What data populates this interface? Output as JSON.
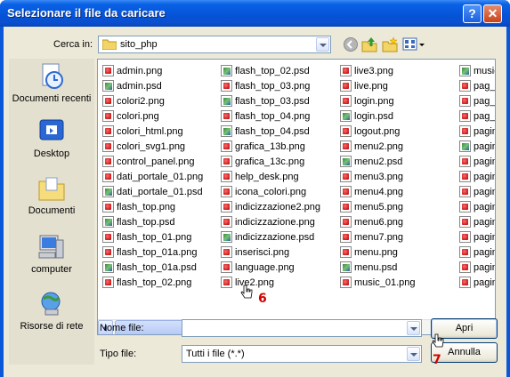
{
  "window": {
    "title": "Selezionare il file da caricare"
  },
  "lookin": {
    "label": "Cerca in:",
    "value": "sito_php"
  },
  "places": [
    {
      "label": "Documenti recenti"
    },
    {
      "label": "Desktop"
    },
    {
      "label": "Documenti"
    },
    {
      "label": "computer"
    },
    {
      "label": "Risorse di rete"
    }
  ],
  "files": {
    "col1": [
      {
        "name": "admin.png",
        "type": "png"
      },
      {
        "name": "admin.psd",
        "type": "psd"
      },
      {
        "name": "colori2.png",
        "type": "png"
      },
      {
        "name": "colori.png",
        "type": "png"
      },
      {
        "name": "colori_html.png",
        "type": "png"
      },
      {
        "name": "colori_svg1.png",
        "type": "png"
      },
      {
        "name": "control_panel.png",
        "type": "png"
      },
      {
        "name": "dati_portale_01.png",
        "type": "png"
      },
      {
        "name": "dati_portale_01.psd",
        "type": "psd"
      },
      {
        "name": "flash_top.png",
        "type": "png"
      },
      {
        "name": "flash_top.psd",
        "type": "psd"
      },
      {
        "name": "flash_top_01.png",
        "type": "png"
      },
      {
        "name": "flash_top_01a.png",
        "type": "png"
      },
      {
        "name": "flash_top_01a.psd",
        "type": "psd"
      },
      {
        "name": "flash_top_02.png",
        "type": "png"
      }
    ],
    "col2": [
      {
        "name": "flash_top_02.psd",
        "type": "psd"
      },
      {
        "name": "flash_top_03.png",
        "type": "png"
      },
      {
        "name": "flash_top_03.psd",
        "type": "psd"
      },
      {
        "name": "flash_top_04.png",
        "type": "png"
      },
      {
        "name": "flash_top_04.psd",
        "type": "psd"
      },
      {
        "name": "grafica_13b.png",
        "type": "png"
      },
      {
        "name": "grafica_13c.png",
        "type": "png"
      },
      {
        "name": "help_desk.png",
        "type": "png"
      },
      {
        "name": "icona_colori.png",
        "type": "png"
      },
      {
        "name": "indicizzazione2.png",
        "type": "png"
      },
      {
        "name": "indicizzazione.png",
        "type": "png"
      },
      {
        "name": "indicizzazione.psd",
        "type": "psd"
      },
      {
        "name": "inserisci.png",
        "type": "png"
      },
      {
        "name": "language.png",
        "type": "png"
      },
      {
        "name": "live2.png",
        "type": "png"
      }
    ],
    "col3": [
      {
        "name": "live3.png",
        "type": "png"
      },
      {
        "name": "live.png",
        "type": "png"
      },
      {
        "name": "login.png",
        "type": "png"
      },
      {
        "name": "login.psd",
        "type": "psd"
      },
      {
        "name": "logout.png",
        "type": "png"
      },
      {
        "name": "menu2.png",
        "type": "png"
      },
      {
        "name": "menu2.psd",
        "type": "psd"
      },
      {
        "name": "menu3.png",
        "type": "png"
      },
      {
        "name": "menu4.png",
        "type": "png"
      },
      {
        "name": "menu5.png",
        "type": "png"
      },
      {
        "name": "menu6.png",
        "type": "png"
      },
      {
        "name": "menu7.png",
        "type": "png"
      },
      {
        "name": "menu.png",
        "type": "png"
      },
      {
        "name": "menu.psd",
        "type": "psd"
      },
      {
        "name": "music_01.png",
        "type": "png"
      }
    ],
    "col4": [
      {
        "name": "music",
        "type": "psd"
      },
      {
        "name": "pag_e",
        "type": "png"
      },
      {
        "name": "pag_e",
        "type": "png"
      },
      {
        "name": "pag_e",
        "type": "png"
      },
      {
        "name": "pagin",
        "type": "png"
      },
      {
        "name": "pagin",
        "type": "psd"
      },
      {
        "name": "pagin",
        "type": "png"
      },
      {
        "name": "pagin",
        "type": "png"
      },
      {
        "name": "pagin",
        "type": "png"
      },
      {
        "name": "pagin",
        "type": "png"
      },
      {
        "name": "pagin",
        "type": "png"
      },
      {
        "name": "pagin",
        "type": "png"
      },
      {
        "name": "pagin",
        "type": "png"
      },
      {
        "name": "pagin",
        "type": "png"
      },
      {
        "name": "pagin",
        "type": "png"
      }
    ]
  },
  "filename": {
    "label": "Nome file:",
    "value": ""
  },
  "filetype": {
    "label": "Tipo file:",
    "value": "Tutti i file (*.*)"
  },
  "buttons": {
    "open": "Apri",
    "cancel": "Annulla"
  },
  "annotations": {
    "step6": "6",
    "step7": "7"
  },
  "colors": {
    "titlebar": "#0a58d8",
    "dialog": "#ece9d8",
    "annotation": "#d00000"
  }
}
